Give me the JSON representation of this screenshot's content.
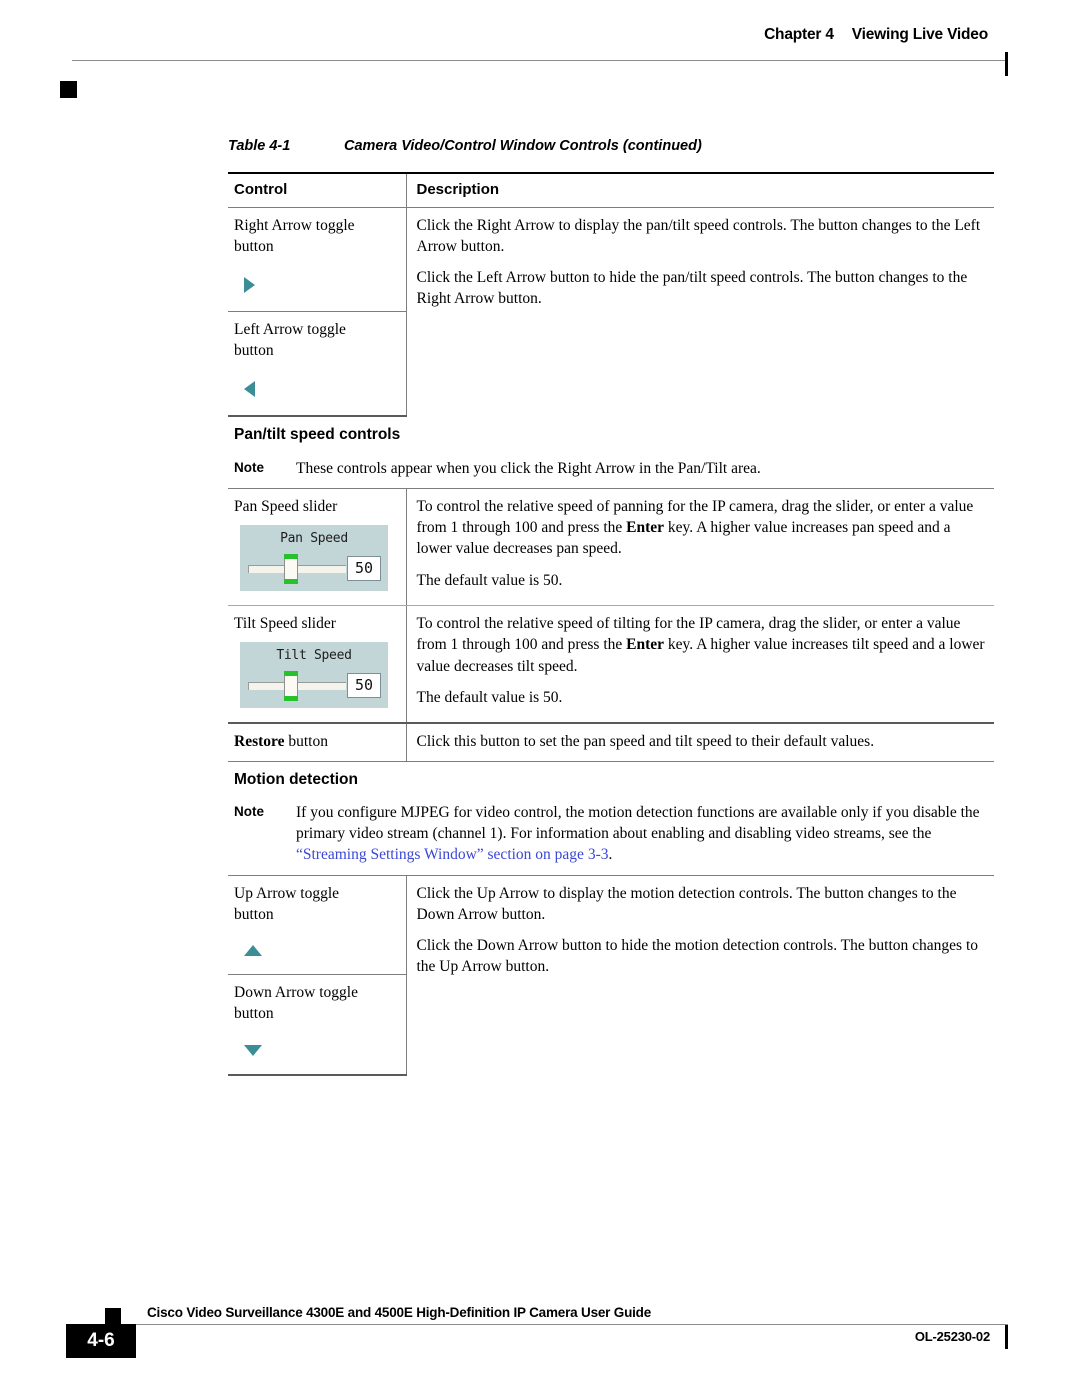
{
  "header": {
    "chapter": "Chapter 4",
    "title": "Viewing Live Video"
  },
  "table": {
    "caption_number": "Table 4-1",
    "caption_title": "Camera Video/Control Window Controls (continued)",
    "columns": {
      "control": "Control",
      "description": "Description"
    },
    "rows": [
      {
        "control_label_line1": "Right Arrow toggle",
        "control_label_line2": "button",
        "icon": "right-arrow-icon",
        "description": "Click the Right Arrow to display the pan/tilt speed controls. The button changes to the Left Arrow button."
      },
      {
        "control_label_line1": "Left Arrow toggle",
        "control_label_line2": "button",
        "icon": "left-arrow-icon",
        "description": "Click the Left Arrow button to hide the pan/tilt speed controls. The button changes to the Right Arrow button."
      }
    ],
    "pantilt_section": {
      "heading": "Pan/tilt speed controls",
      "note_label": "Note",
      "note_text": "These controls appear when you click the Right Arrow in the Pan/Tilt area."
    },
    "pan_speed_row": {
      "control_label": "Pan Speed slider",
      "widget": {
        "title": "Pan Speed",
        "value": "50"
      },
      "description_p1_a": "To control the relative speed of panning for the IP camera, drag the slider, or enter a value from 1 through 100 and press the ",
      "description_p1_bold": "Enter",
      "description_p1_b": " key. A higher value increases pan speed and a lower value decreases pan speed.",
      "description_p2": "The default value is 50."
    },
    "tilt_speed_row": {
      "control_label": "Tilt Speed slider",
      "widget": {
        "title": "Tilt Speed",
        "value": "50"
      },
      "description_p1_a": "To control the relative speed of tilting for the IP camera, drag the slider, or enter a value from 1 through 100 and press the ",
      "description_p1_bold": "Enter",
      "description_p1_b": " key. A higher value increases tilt speed and a lower value decreases tilt speed.",
      "description_p2": "The default value is 50."
    },
    "restore_row": {
      "control_label_bold": "Restore",
      "control_label_rest": " button",
      "description": "Click this button to set the pan speed and tilt speed to their default values."
    },
    "motion_section": {
      "heading": "Motion detection",
      "note_label": "Note",
      "note_text_a": "If you configure MJPEG for video control, the motion detection functions are available only if you disable the primary video stream (channel 1). For information about enabling and disabling video streams, see the ",
      "note_link": "“Streaming Settings Window” section on page 3-3",
      "note_text_b": "."
    },
    "motion_rows": [
      {
        "control_label_line1": "Up Arrow toggle",
        "control_label_line2": "button",
        "icon": "up-arrow-icon",
        "description": "Click the Up Arrow to display the motion detection controls. The button changes to the Down Arrow button."
      },
      {
        "control_label_line1": "Down Arrow toggle",
        "control_label_line2": "button",
        "icon": "down-arrow-icon",
        "description": "Click the Down Arrow button to hide the motion detection controls. The button changes to the Up Arrow button."
      }
    ]
  },
  "footer": {
    "page_number": "4-6",
    "document_title": "Cisco Video Surveillance 4300E and 4500E High-Definition IP Camera User Guide",
    "document_id": "OL-25230-02"
  },
  "colors": {
    "link": "#3b47d6",
    "icon_teal": "#3c8e96",
    "widget_background": "#c3d6d7",
    "thumb_green": "#27c22b"
  }
}
